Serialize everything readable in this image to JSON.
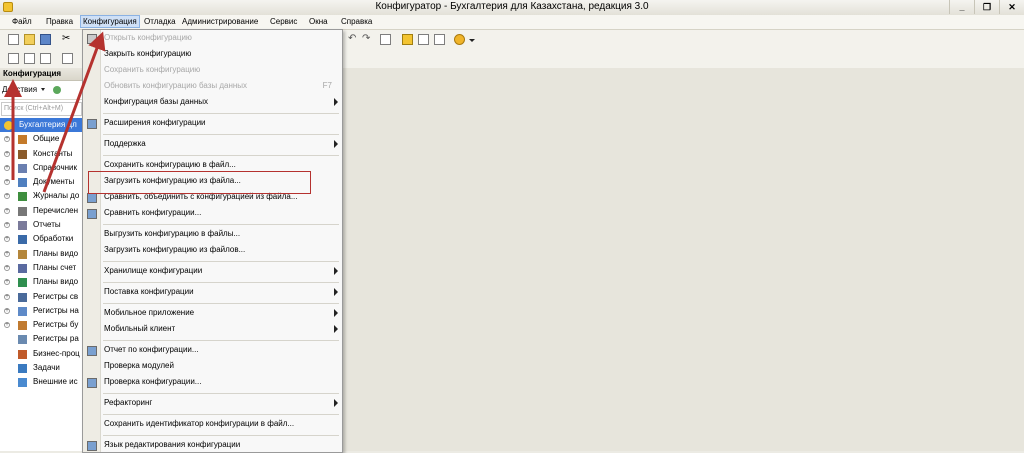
{
  "window": {
    "title": "Конфигуратор - Бухгалтерия для Казахстана, редакция 3.0",
    "controls": [
      "_",
      "❐",
      "✕"
    ]
  },
  "menubar": [
    {
      "label": "Файл",
      "active": false
    },
    {
      "label": "Правка",
      "active": false
    },
    {
      "label": "Конфигурация",
      "active": true
    },
    {
      "label": "Отладка",
      "active": false
    },
    {
      "label": "Администрирование",
      "active": false
    },
    {
      "label": "Сервис",
      "active": false
    },
    {
      "label": "Окна",
      "active": false
    },
    {
      "label": "Справка",
      "active": false
    }
  ],
  "left_panel": {
    "title": "Конфигурация",
    "actions_label": "Действия",
    "search_placeholder": "Поиск (Ctrl+Alt+M)",
    "root_label": "Бухгалтерия дл",
    "tree": [
      {
        "label": "Общие",
        "expandable": true,
        "icon": "common-icon"
      },
      {
        "label": "Константы",
        "expandable": true,
        "icon": "constants-icon"
      },
      {
        "label": "Справочник",
        "expandable": true,
        "icon": "catalogs-icon"
      },
      {
        "label": "Документы",
        "expandable": true,
        "icon": "documents-icon"
      },
      {
        "label": "Журналы до",
        "expandable": true,
        "icon": "journals-icon"
      },
      {
        "label": "Перечислен",
        "expandable": true,
        "icon": "enums-icon"
      },
      {
        "label": "Отчеты",
        "expandable": true,
        "icon": "reports-icon"
      },
      {
        "label": "Обработки",
        "expandable": true,
        "icon": "processing-icon"
      },
      {
        "label": "Планы видо",
        "expandable": true,
        "icon": "chart-types-icon"
      },
      {
        "label": "Планы счет",
        "expandable": true,
        "icon": "chart-accounts-icon"
      },
      {
        "label": "Планы видо",
        "expandable": true,
        "icon": "calc-types-icon"
      },
      {
        "label": "Регистры св",
        "expandable": true,
        "icon": "info-registers-icon"
      },
      {
        "label": "Регистры на",
        "expandable": true,
        "icon": "accum-registers-icon"
      },
      {
        "label": "Регистры бу",
        "expandable": true,
        "icon": "acc-registers-icon"
      },
      {
        "label": "Регистры ра",
        "expandable": false,
        "icon": "calc-registers-icon"
      },
      {
        "label": "Бизнес-проц",
        "expandable": false,
        "icon": "business-process-icon"
      },
      {
        "label": "Задачи",
        "expandable": false,
        "icon": "tasks-icon"
      },
      {
        "label": "Внешние ис",
        "expandable": false,
        "icon": "external-sources-icon"
      }
    ]
  },
  "config_menu": [
    {
      "type": "item",
      "label": "Открыть конфигурацию",
      "disabled": true,
      "icon": "open-config-icon"
    },
    {
      "type": "item",
      "label": "Закрыть конфигурацию",
      "disabled": false
    },
    {
      "type": "item",
      "label": "Сохранить конфигурацию",
      "disabled": true
    },
    {
      "type": "item",
      "label": "Обновить конфигурацию базы данных",
      "disabled": true,
      "shortcut": "F7"
    },
    {
      "type": "item",
      "label": "Конфигурация базы данных",
      "disabled": false,
      "submenu": true
    },
    {
      "type": "sep"
    },
    {
      "type": "item",
      "label": "Расширения конфигурации",
      "disabled": false,
      "icon": "extensions-icon"
    },
    {
      "type": "sep"
    },
    {
      "type": "item",
      "label": "Поддержка",
      "disabled": false,
      "submenu": true
    },
    {
      "type": "sep"
    },
    {
      "type": "item",
      "label": "Сохранить конфигурацию в файл...",
      "disabled": false
    },
    {
      "type": "item",
      "label": "Загрузить конфигурацию из файла...",
      "disabled": false,
      "highlighted": true
    },
    {
      "type": "item",
      "label": "Сравнить, объединить с конфигурацией из файла...",
      "disabled": false,
      "icon": "compare-merge-icon"
    },
    {
      "type": "item",
      "label": "Сравнить конфигурации...",
      "disabled": false,
      "icon": "compare-icon"
    },
    {
      "type": "sep"
    },
    {
      "type": "item",
      "label": "Выгрузить конфигурацию в файлы...",
      "disabled": false
    },
    {
      "type": "item",
      "label": "Загрузить конфигурацию из файлов...",
      "disabled": false
    },
    {
      "type": "sep"
    },
    {
      "type": "item",
      "label": "Хранилище конфигурации",
      "disabled": false,
      "submenu": true
    },
    {
      "type": "sep"
    },
    {
      "type": "item",
      "label": "Поставка конфигурации",
      "disabled": false,
      "submenu": true
    },
    {
      "type": "sep"
    },
    {
      "type": "item",
      "label": "Мобильное приложение",
      "disabled": false,
      "submenu": true
    },
    {
      "type": "item",
      "label": "Мобильный клиент",
      "disabled": false,
      "submenu": true
    },
    {
      "type": "sep"
    },
    {
      "type": "item",
      "label": "Отчет по конфигурации...",
      "disabled": false,
      "icon": "report-icon"
    },
    {
      "type": "item",
      "label": "Проверка модулей",
      "disabled": false
    },
    {
      "type": "item",
      "label": "Проверка конфигурации...",
      "disabled": false,
      "icon": "check-icon"
    },
    {
      "type": "sep"
    },
    {
      "type": "item",
      "label": "Рефакторинг",
      "disabled": false,
      "submenu": true
    },
    {
      "type": "sep"
    },
    {
      "type": "item",
      "label": "Сохранить идентификатор конфигурации в файл...",
      "disabled": false
    },
    {
      "type": "sep"
    },
    {
      "type": "item",
      "label": "Язык редактирования конфигурации",
      "disabled": false,
      "icon": "language-icon"
    }
  ],
  "colors": {
    "annotation_red": "#b5322f",
    "selection_blue": "#3b78d8"
  }
}
